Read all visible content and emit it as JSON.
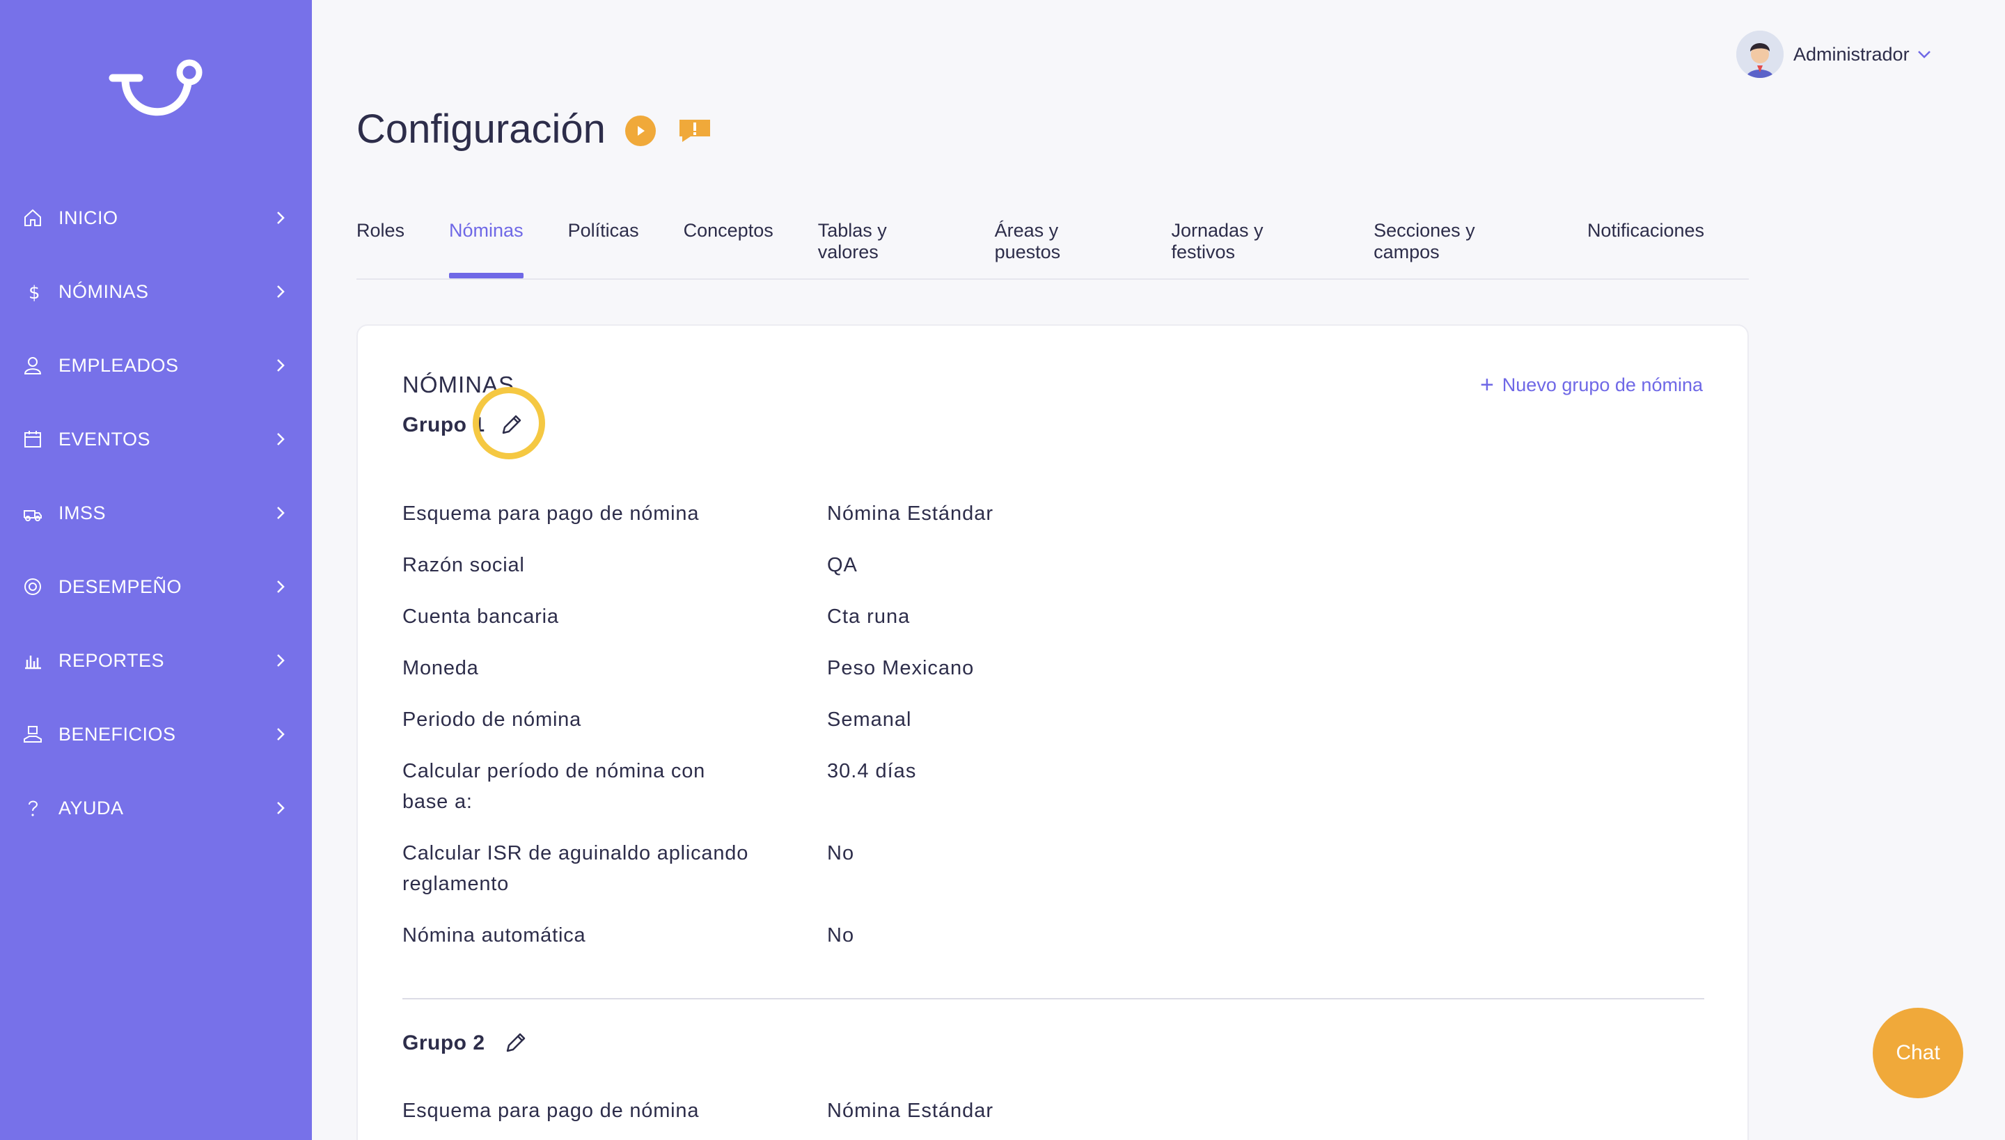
{
  "sidebar": {
    "logo_icon": "smile-logo-icon",
    "items": [
      {
        "label": "INICIO",
        "icon": "home-icon"
      },
      {
        "label": "NÓMINAS",
        "icon": "dollar-icon"
      },
      {
        "label": "EMPLEADOS",
        "icon": "user-icon"
      },
      {
        "label": "EVENTOS",
        "icon": "calendar-icon"
      },
      {
        "label": "IMSS",
        "icon": "ambulance-icon"
      },
      {
        "label": "DESEMPEÑO",
        "icon": "target-icon"
      },
      {
        "label": "REPORTES",
        "icon": "bar-chart-icon"
      },
      {
        "label": "BENEFICIOS",
        "icon": "gift-hand-icon"
      },
      {
        "label": "AYUDA",
        "icon": "question-icon"
      }
    ]
  },
  "header": {
    "user_name": "Administrador",
    "title": "Configuración"
  },
  "tabs": [
    {
      "label": "Roles",
      "active": false
    },
    {
      "label": "Nóminas",
      "active": true
    },
    {
      "label": "Políticas",
      "active": false
    },
    {
      "label": "Conceptos",
      "active": false
    },
    {
      "label": "Tablas y valores",
      "active": false
    },
    {
      "label": "Áreas y puestos",
      "active": false
    },
    {
      "label": "Jornadas y festivos",
      "active": false
    },
    {
      "label": "Secciones y campos",
      "active": false
    },
    {
      "label": "Notificaciones",
      "active": false
    }
  ],
  "card": {
    "title": "NÓMINAS",
    "new_group_plus": "+",
    "new_group_label": "Nuevo grupo de nómina"
  },
  "groups": [
    {
      "title": "Grupo 1",
      "fields": [
        {
          "label": "Esquema para pago de nómina",
          "value": "Nómina Estándar"
        },
        {
          "label": "Razón social",
          "value": "QA"
        },
        {
          "label": "Cuenta bancaria",
          "value": "Cta runa"
        },
        {
          "label": "Moneda",
          "value": "Peso Mexicano"
        },
        {
          "label": "Periodo de nómina",
          "value": "Semanal"
        },
        {
          "label": "Calcular período de nómina con base a:",
          "value": "30.4 días"
        },
        {
          "label": "Calcular ISR de aguinaldo aplicando reglamento",
          "value": "No"
        },
        {
          "label": "Nómina automática",
          "value": "No"
        }
      ]
    },
    {
      "title": "Grupo 2",
      "fields": [
        {
          "label": "Esquema para pago de nómina",
          "value": "Nómina Estándar"
        }
      ]
    }
  ],
  "chat_label": "Chat",
  "colors": {
    "sidebar": "#7771e9",
    "accent": "#6f68e6",
    "orange": "#f0a93a",
    "highlight": "#f5c842"
  }
}
